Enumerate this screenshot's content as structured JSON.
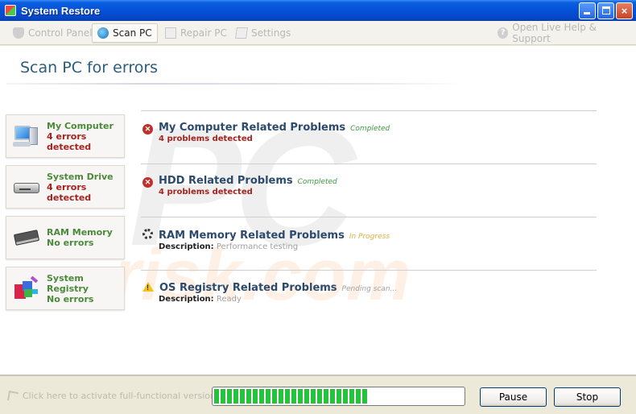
{
  "window": {
    "title": "System Restore",
    "controls": {
      "minimize": "minimize",
      "maximize": "maximize",
      "close": "×"
    }
  },
  "toolbar": {
    "items": [
      {
        "label": "Control Panel",
        "icon": "shield-icon",
        "active": false
      },
      {
        "label": "Scan PC",
        "icon": "scan-icon",
        "active": true
      },
      {
        "label": "Repair PC",
        "icon": "repair-icon",
        "active": false
      },
      {
        "label": "Settings",
        "icon": "settings-icon",
        "active": false
      }
    ],
    "help": {
      "label": "Open Live Help & Support",
      "icon": "help-icon",
      "glyph": "?"
    }
  },
  "main": {
    "title": "Scan PC for errors",
    "watermark": {
      "line1": "PC",
      "line2": "risk.com"
    },
    "categories": [
      {
        "name": "My Computer",
        "status": "4 errors detected",
        "state": "error",
        "icon": "computer-icon"
      },
      {
        "name": "System Drive",
        "status": "4 errors detected",
        "state": "error",
        "icon": "drive-icon"
      },
      {
        "name": "RAM Memory",
        "status": "No errors",
        "state": "ok",
        "icon": "ram-icon"
      },
      {
        "name": "System Registry",
        "status": "No errors",
        "state": "ok",
        "icon": "registry-icon"
      }
    ],
    "problems": [
      {
        "title": "My Computer Related Problems",
        "state": "Completed",
        "status_icon": "error-icon",
        "error_glyph": "✕",
        "detail": "4 problems detected"
      },
      {
        "title": "HDD Related Problems",
        "state": "Completed",
        "status_icon": "error-icon",
        "error_glyph": "✕",
        "detail": "4 problems detected"
      },
      {
        "title": "RAM Memory Related Problems",
        "state": "In Progress",
        "status_icon": "spinner-icon",
        "desc_label": "Description:",
        "desc_value": "Performance testing"
      },
      {
        "title": "OS Registry Related Problems",
        "state": "Pending scan...",
        "status_icon": "warning-icon",
        "warn_glyph": "!",
        "desc_label": "Description:",
        "desc_value": "Ready"
      }
    ]
  },
  "footer": {
    "activate_label": "Click here to activate full-functional version",
    "progress_percent": 62,
    "pause_label": "Pause",
    "stop_label": "Stop"
  },
  "colors": {
    "titlebar": "#0551d8",
    "heading": "#2c5d7f",
    "category_name": "#4a8a3a",
    "error": "#a4231f",
    "completed": "#3c9c3c",
    "in_progress": "#d6b23c",
    "progress_fill": "#25c33a"
  }
}
